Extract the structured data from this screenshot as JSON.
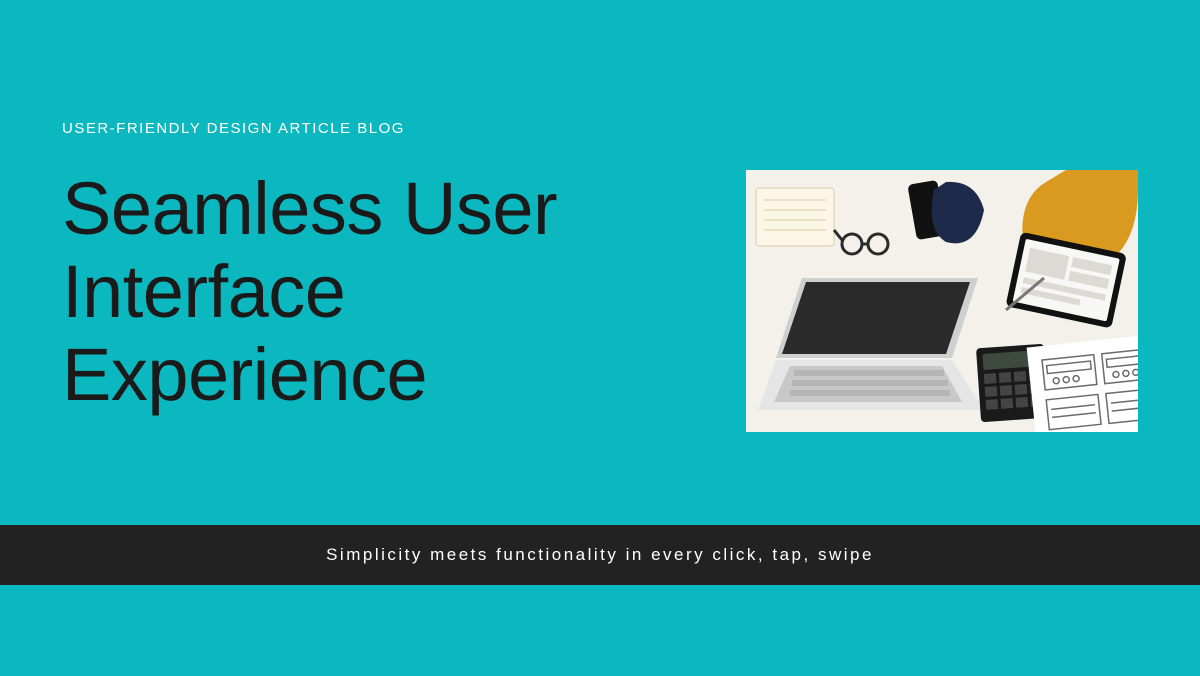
{
  "eyebrow": "USER-FRIENDLY DESIGN ARTICLE BLOG",
  "headline": "Seamless User Interface Experience",
  "tagline": "Simplicity meets functionality in every click, tap, swipe",
  "illustration_name": "ux-workspace-photo",
  "colors": {
    "background": "#0cb8c0",
    "headline": "#1a1a1a",
    "eyebrow": "#ffffff",
    "bar_bg": "#222222",
    "bar_text": "#ffffff"
  }
}
